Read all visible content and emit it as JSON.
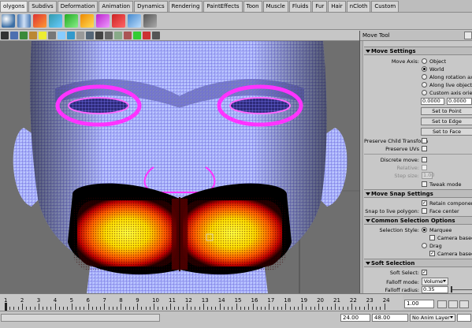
{
  "shelf": {
    "tabs": [
      "olygons",
      "Subdivs",
      "Deformation",
      "Animation",
      "Dynamics",
      "Rendering",
      "PaintEffects",
      "Toon",
      "Muscle",
      "Fluids",
      "Fur",
      "Hair",
      "nCloth",
      "Custom"
    ],
    "active_tab": 0
  },
  "tool_panel": {
    "title": "Move Tool",
    "move_settings": {
      "header": "Move Settings",
      "move_axis_label": "Move Axis:",
      "axis_options": [
        "Object",
        "World",
        "Along rotation axis",
        "Along live object axis",
        "Custom axis orientation"
      ],
      "axis_selected": "World",
      "custom_values": [
        "0.0000",
        "0.0000"
      ],
      "set_to_point": "Set to Point",
      "set_to_edge": "Set to Edge",
      "set_to_face": "Set to Face",
      "preserve_child": "Preserve Child Transform",
      "preserve_uvs": "Preserve UVs",
      "discrete_move": "Discrete move:",
      "relative": "Relative:",
      "step_size": "Step size:",
      "step_value": "1.00",
      "tweak_mode": "Tweak mode"
    },
    "move_snap": {
      "header": "Move Snap Settings",
      "retain_spacing": "Retain component sp",
      "snap_live": "Snap to live polygon:",
      "face_center": "Face center"
    },
    "common_selection": {
      "header": "Common Selection Options",
      "selection_style": "Selection Style:",
      "marquee": "Marquee",
      "camera_based_sel": "Camera based se",
      "drag": "Drag",
      "camera_based_paint": "Camera based pa"
    },
    "soft_selection": {
      "header": "Soft Selection",
      "soft_select": "Soft Select:",
      "falloff_mode": "Falloff mode:",
      "falloff_value": "Volume",
      "falloff_radius": "Falloff radius:",
      "radius_value": "0.35"
    }
  },
  "timeline": {
    "ticks": [
      "1",
      "2",
      "3",
      "4",
      "5",
      "6",
      "7",
      "8",
      "9",
      "10",
      "11",
      "12",
      "13",
      "14",
      "15",
      "16",
      "17",
      "18",
      "19",
      "20",
      "21",
      "22",
      "23",
      "24"
    ],
    "current_frame": "1.00"
  },
  "range": {
    "start": "24.00",
    "end": "48.00",
    "anim_layer": "No Anim Layer"
  },
  "colors": {
    "wire": "#7a7aff",
    "select_highlight": "#ff33ff",
    "soft_hot": "#ffff00",
    "soft_mid": "#ff2200"
  }
}
